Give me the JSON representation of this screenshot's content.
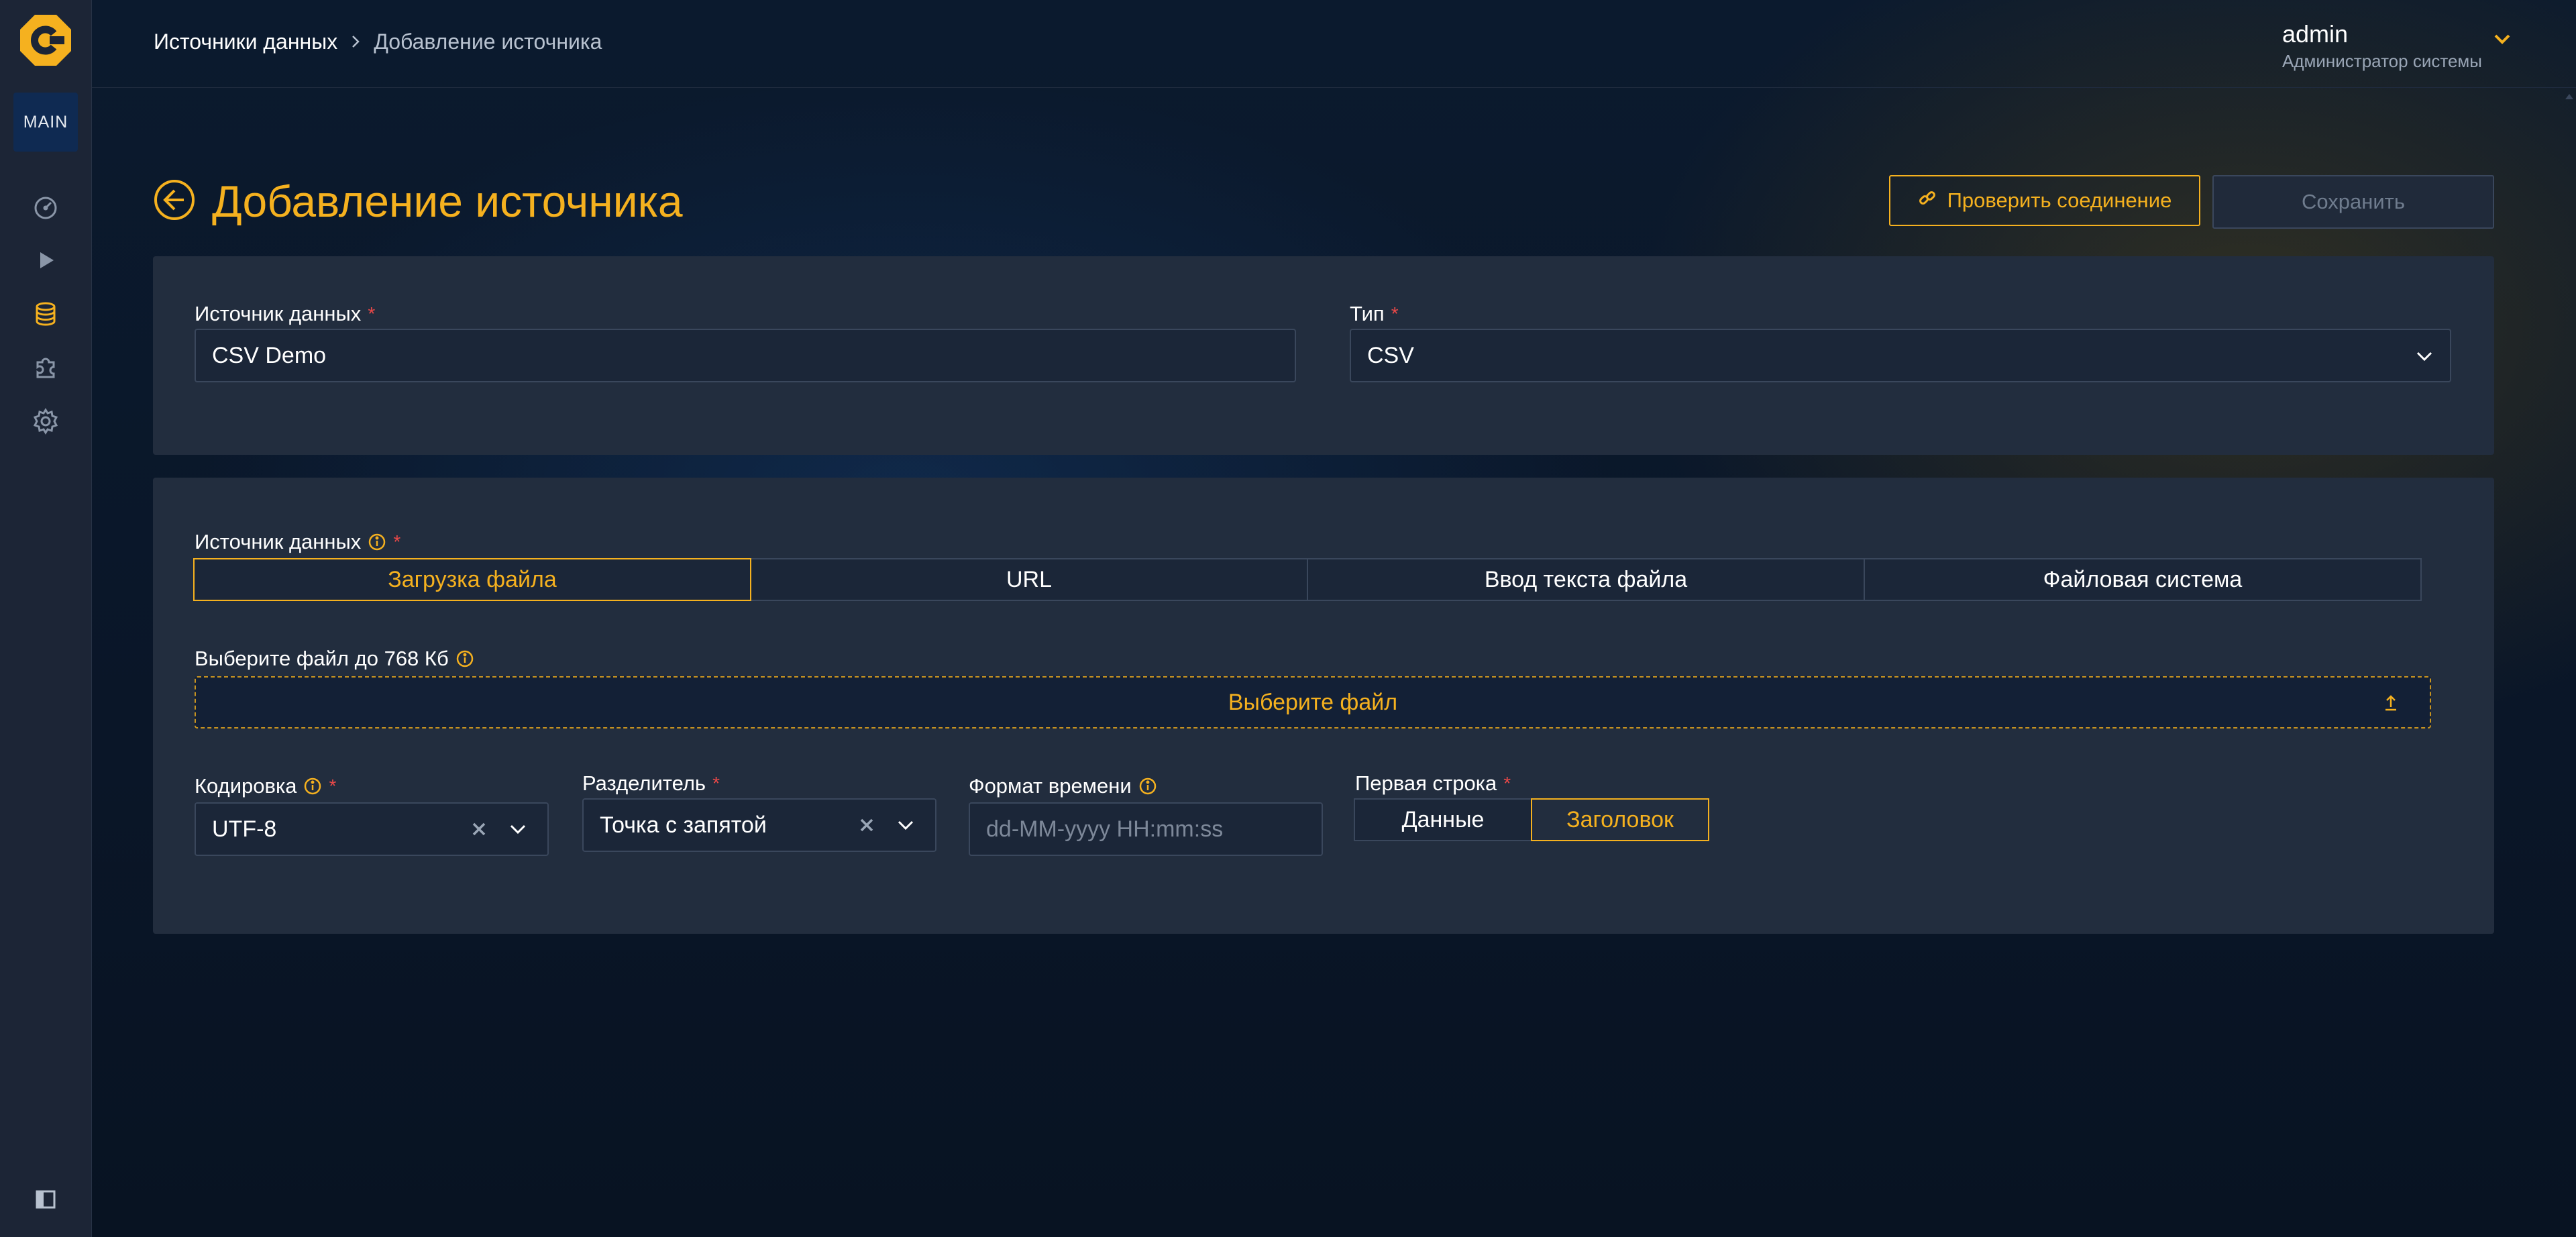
{
  "nav": {
    "badge": "MAIN",
    "items": [
      {
        "icon": "dashboard-icon"
      },
      {
        "icon": "play-icon"
      },
      {
        "icon": "database-icon",
        "active": true
      },
      {
        "icon": "puzzle-icon"
      },
      {
        "icon": "gear-icon"
      }
    ]
  },
  "breadcrumb": {
    "link": "Источники данных",
    "current": "Добавление источника"
  },
  "user": {
    "name": "admin",
    "role": "Администратор системы"
  },
  "page": {
    "title": "Добавление источника",
    "check_button": "Проверить соединение",
    "save_button": "Сохранить"
  },
  "form": {
    "source_name": {
      "label": "Источник данных",
      "value": "CSV Demo"
    },
    "type": {
      "label": "Тип",
      "value": "CSV"
    },
    "data_source": {
      "label": "Источник данных",
      "options": [
        "Загрузка файла",
        "URL",
        "Ввод текста файла",
        "Файловая система"
      ],
      "selected": "Загрузка файла"
    },
    "file": {
      "label": "Выберите файл до 768 Кб",
      "button": "Выберите файл"
    },
    "encoding": {
      "label": "Кодировка",
      "value": "UTF-8"
    },
    "delimiter": {
      "label": "Разделитель",
      "value": "Точка с запятой"
    },
    "time_format": {
      "label": "Формат времени",
      "placeholder": "dd-MM-yyyy HH:mm:ss"
    },
    "first_row": {
      "label": "Первая строка",
      "options": [
        "Данные",
        "Заголовок"
      ],
      "selected": "Заголовок"
    }
  },
  "colors": {
    "accent": "#f5b11f",
    "required": "#e84848",
    "panel": "#222d3e",
    "sidebar": "#1c2536"
  }
}
